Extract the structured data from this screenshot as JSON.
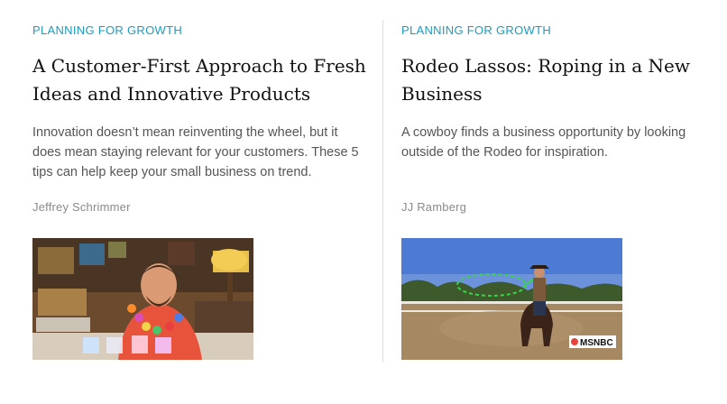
{
  "articles": [
    {
      "category": "PLANNING FOR GROWTH",
      "title": "A Customer-First Approach to Fresh Ideas and Innovative Products",
      "summary": "Innovation doesn’t mean reinventing the wheel, but it does mean staying relevant for your customers. These 5 tips can help keep your small business on trend.",
      "author": "Jeffrey Schrimmer"
    },
    {
      "category": "PLANNING FOR GROWTH",
      "title": "Rodeo Lassos: Roping in a New Business",
      "summary": "A cowboy finds a business opportunity by looking outside of the Rodeo for inspiration.",
      "author": "JJ Ramberg",
      "video_badge": "MSNBC"
    }
  ],
  "colors": {
    "kicker": "#1b9bc2",
    "byline": "#8a8a8a",
    "divider": "#dedede"
  }
}
